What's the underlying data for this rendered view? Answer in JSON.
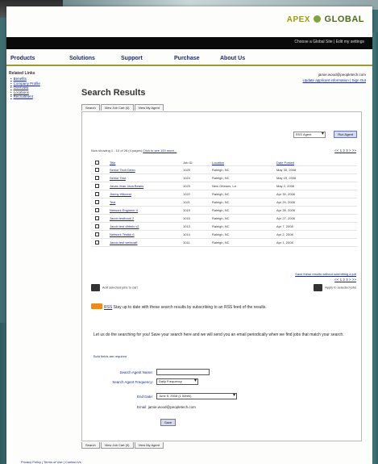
{
  "brand": {
    "name_left": "APEX",
    "name_right": "GLOBAL"
  },
  "topbar": {
    "links": "Choose a Global Site | Edit my settings"
  },
  "nav": {
    "items": [
      "Products",
      "Solutions",
      "Support",
      "Purchase",
      "About Us"
    ]
  },
  "sidebar": {
    "header": "Related Links",
    "items": [
      "Benefits",
      "Company Profile",
      "Overview",
      "Locations",
      "Recruitment"
    ]
  },
  "user": {
    "email": "jamie.wood@peopletech.com",
    "links": "Update applicant information | Sign Out"
  },
  "page": {
    "title": "Search Results"
  },
  "tabs": [
    "Search",
    "View Job Cart (0)",
    "View My Agent"
  ],
  "rss": {
    "select_value": "RSS Agent",
    "button": "Run Agent"
  },
  "results": {
    "showing_text": "Now showing 1 - 10 of 28 (4 pages)",
    "showing_link": "Click to see 100 more...",
    "pager": "<< 1 2 3 > >>",
    "columns": [
      "Title",
      "Job ID",
      "Location",
      "Date Posted"
    ],
    "rows": [
      {
        "title": "Senior Tech Dean",
        "id": "1025",
        "loc": "Raleigh, NC",
        "date": "May 30, 2008"
      },
      {
        "title": "Senior Test",
        "id": "1024",
        "loc": "Raleigh, NC",
        "date": "May 15, 2008"
      },
      {
        "title": "Javas Jean Java Beans",
        "id": "1023",
        "loc": "New Orleans, La",
        "date": "May 2, 2008"
      },
      {
        "title": "Jimmy Hillcrest",
        "id": "1022",
        "loc": "Raleigh, NC",
        "date": "Apr 30, 2008"
      },
      {
        "title": "Test",
        "id": "1021",
        "loc": "Raleigh, NC",
        "date": "Apr 29, 2008"
      },
      {
        "title": "Network Engineer II",
        "id": "1019",
        "loc": "Raleigh, NC",
        "date": "Apr 28, 2008"
      },
      {
        "title": "Jacob testbook 2",
        "id": "1015",
        "loc": "Raleigh, NC",
        "date": "Apr 27, 2008"
      },
      {
        "title": "Jacob test dhtmlx v2",
        "id": "1013",
        "loc": "Raleigh, NC",
        "date": "Apr 7, 2008"
      },
      {
        "title": "Network Testbk 6",
        "id": "1014",
        "loc": "Raleigh, NC",
        "date": "Apr 2, 2008"
      },
      {
        "title": "Jacob test webcraft",
        "id": "1011",
        "loc": "Raleigh, NC",
        "date": "Apr 1, 2008"
      }
    ],
    "save_all": "Save these results without submitting a job",
    "add_selected": "Add selected jobs to cart",
    "apply_selected": "Apply to selected jobs"
  },
  "rss_notice": {
    "link": "RSS",
    "text": "Stay up to date with these search results by subscribing to an RSS feed of the results."
  },
  "agent": {
    "intro": "Let us do the searching for you! Save your search here and we will send you an email periodically when we find jobs that match your search.",
    "indicates": "Bold fields are required",
    "name_label": "Search Agent Name:",
    "name_value": "",
    "freq_label": "Search Agent Frequency:",
    "freq_value": "Daily Frequency",
    "end_label": "End Date:",
    "end_value": "June 5, 2008  (1 Week)",
    "email_label": "Email:",
    "email_value": "jamie.wood@peopletech.com",
    "save_button": "Save"
  },
  "footer": {
    "links": "Privacy Policy | Terms of Use | Contact Us"
  }
}
